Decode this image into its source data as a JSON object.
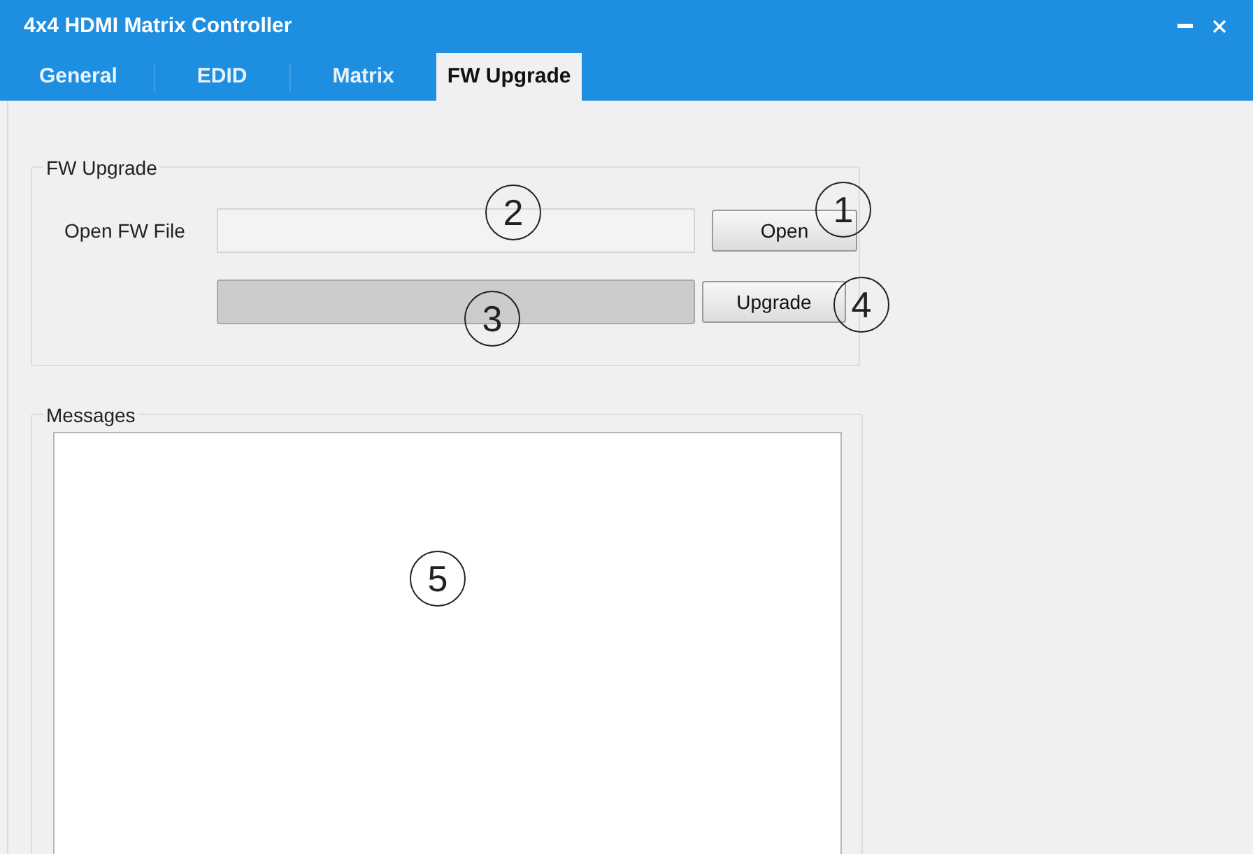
{
  "window": {
    "title": "4x4 HDMI Matrix Controller"
  },
  "tabs": [
    {
      "label": "General",
      "selected": false
    },
    {
      "label": "EDID",
      "selected": false
    },
    {
      "label": "Matrix",
      "selected": false
    },
    {
      "label": "FW Upgrade",
      "selected": true
    }
  ],
  "fw_upgrade": {
    "title": "FW Upgrade",
    "file_label": "Open FW File",
    "open_button": "Open",
    "progress": {
      "level": 0
    },
    "upgrade_button": "Upgrade"
  },
  "messages": {
    "title": "Messages"
  },
  "callouts": [
    {
      "label": "1"
    },
    {
      "label": "2"
    },
    {
      "label": "3"
    },
    {
      "label": "4"
    },
    {
      "label": "5"
    }
  ]
}
